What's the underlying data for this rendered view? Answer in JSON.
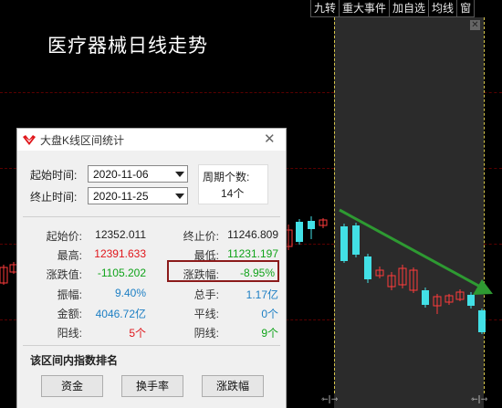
{
  "toolbar": {
    "buttons": [
      {
        "label": "九转"
      },
      {
        "label": "重大事件"
      },
      {
        "label": "加自选"
      },
      {
        "label": "均线"
      },
      {
        "label": "窗"
      }
    ]
  },
  "chart": {
    "title": "医疗器械日线走势",
    "close_icon": "close-icon",
    "colors": {
      "up": "#ff3b3b",
      "down": "#42e0e6",
      "arrow": "#2e9a32",
      "selection_line": "#d6c64a",
      "selection_bg": "#2b2b2b"
    },
    "markers": [
      "⇽|⇾",
      "⇽|⇾"
    ]
  },
  "dialog": {
    "title": "大盘K线区间统计",
    "start_label": "起始时间:",
    "start_value": "2020-11-06",
    "end_label": "终止时间:",
    "end_value": "2020-11-25",
    "period_label": "周期个数:",
    "period_value": "14个",
    "stats": {
      "start_price_label": "起始价:",
      "start_price": "12352.011",
      "end_price_label": "终止价:",
      "end_price": "11246.809",
      "high_label": "最高:",
      "high": "12391.633",
      "low_label": "最低:",
      "low": "11231.197",
      "change_label": "涨跌值:",
      "change": "-1105.202",
      "pct_label": "涨跌幅:",
      "pct": "-8.95%",
      "amp_label": "振幅:",
      "amp": "9.40%",
      "vol_label": "总手:",
      "vol": "1.17亿",
      "amount_label": "金额:",
      "amount": "4046.72亿",
      "flat_label": "平线:",
      "flat": "0个",
      "up_label": "阳线:",
      "up": "5个",
      "down_label": "阴线:",
      "down": "9个"
    },
    "rank_title": "该区间内指数排名",
    "buttons": {
      "fund": "资金",
      "turnover": "换手率",
      "change": "涨跌幅"
    },
    "colors": {
      "red": "#e0161b",
      "green": "#10a31a",
      "blue": "#1d7fc4"
    }
  }
}
